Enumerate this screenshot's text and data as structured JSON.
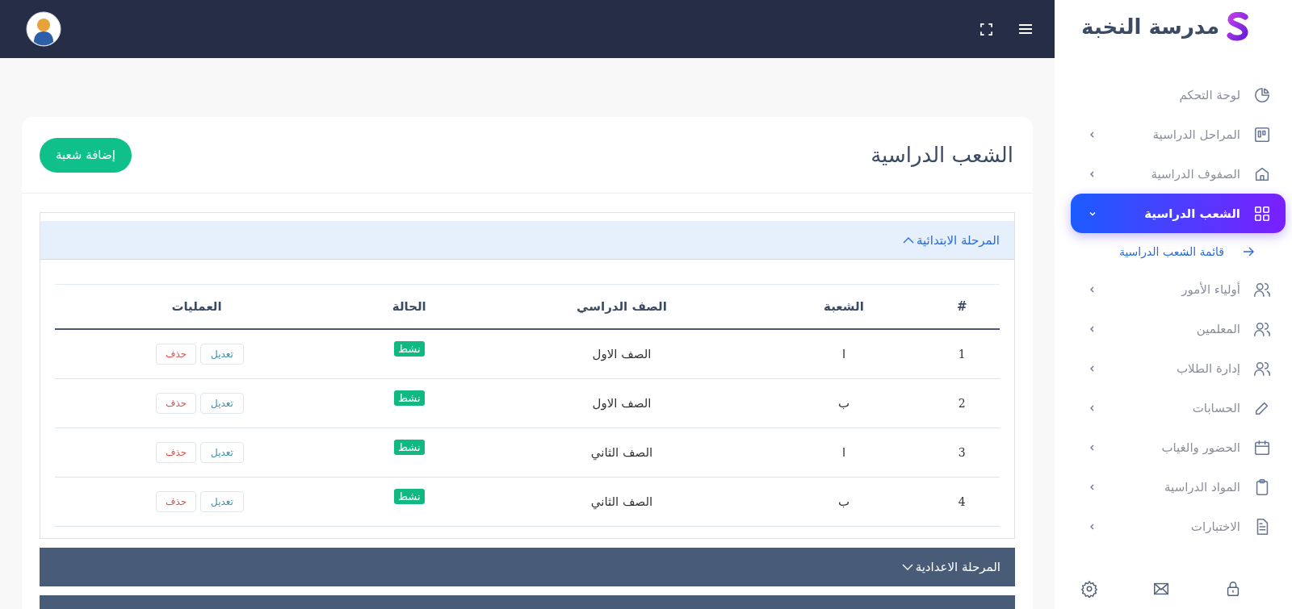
{
  "brand": {
    "name": "مدرسة النخبة"
  },
  "sidebar": {
    "items": [
      {
        "label": "لوحة التحكم",
        "has_chevron": false,
        "selected": false
      },
      {
        "label": "المراحل الدراسية",
        "has_chevron": true,
        "selected": false
      },
      {
        "label": "الصفوف الدراسية",
        "has_chevron": true,
        "selected": false
      },
      {
        "label": "الشعب الدراسية",
        "has_chevron": true,
        "selected": true,
        "expanded": true,
        "children": [
          {
            "label": "قائمة الشعب الدراسية",
            "selected": true
          }
        ]
      },
      {
        "label": "أولياء الأمور",
        "has_chevron": true,
        "selected": false
      },
      {
        "label": "المعلمين",
        "has_chevron": true,
        "selected": false
      },
      {
        "label": "إدارة الطلاب",
        "has_chevron": true,
        "selected": false
      },
      {
        "label": "الحسابات",
        "has_chevron": true,
        "selected": false
      },
      {
        "label": "الحضور والغياب",
        "has_chevron": true,
        "selected": false
      },
      {
        "label": "المواد الدراسية",
        "has_chevron": true,
        "selected": false
      },
      {
        "label": "الاختبارات",
        "has_chevron": true,
        "selected": false
      }
    ]
  },
  "page": {
    "title": "الشعب الدراسية",
    "add_button": "إضافة شعبة"
  },
  "sections": [
    {
      "title": "المرحلة الابتدائية",
      "expanded": true,
      "table": {
        "columns": [
          "#",
          "الشعبة",
          "الصف الدراسي",
          "الحالة",
          "العمليات"
        ],
        "rows": [
          {
            "number": "1",
            "section": "ا",
            "grade": "الصف الاول",
            "status": "نشط",
            "actions": [
              {
                "label": "تعديل",
                "kind": "edit"
              },
              {
                "label": "حذف",
                "kind": "delete"
              }
            ]
          },
          {
            "number": "2",
            "section": "ب",
            "grade": "الصف الاول",
            "status": "نشط",
            "actions": [
              {
                "label": "تعديل",
                "kind": "edit"
              },
              {
                "label": "حذف",
                "kind": "delete"
              }
            ]
          },
          {
            "number": "3",
            "section": "ا",
            "grade": "الصف الثاني",
            "status": "نشط",
            "actions": [
              {
                "label": "تعديل",
                "kind": "edit"
              },
              {
                "label": "حذف",
                "kind": "delete"
              }
            ]
          },
          {
            "number": "4",
            "section": "ب",
            "grade": "الصف الثاني",
            "status": "نشط",
            "actions": [
              {
                "label": "تعديل",
                "kind": "edit"
              },
              {
                "label": "حذف",
                "kind": "delete"
              }
            ]
          }
        ]
      }
    },
    {
      "title": "المرحلة الاعدادية",
      "expanded": false
    },
    {
      "expanded": false
    }
  ]
}
